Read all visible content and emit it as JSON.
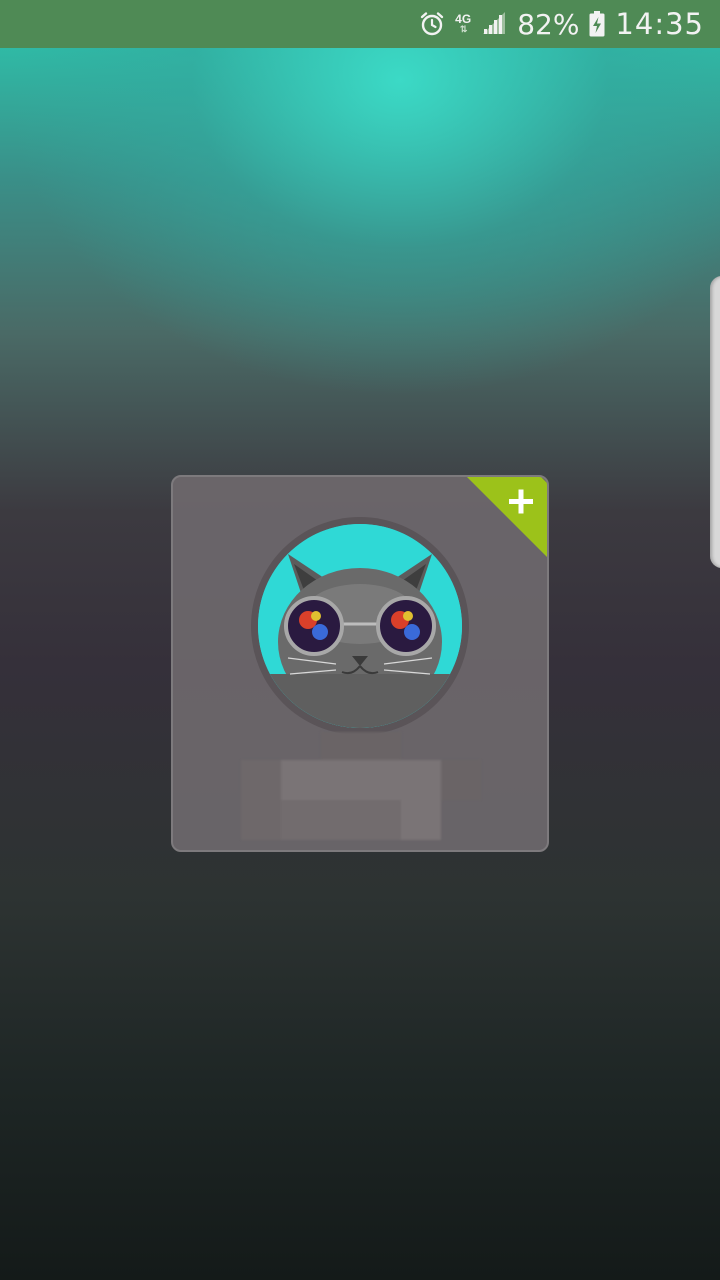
{
  "status_bar": {
    "network_type": "4G",
    "battery_percent": "82%",
    "time": "14:35",
    "icons": [
      "alarm-icon",
      "network-4g-icon",
      "signal-icon",
      "battery-charging-icon"
    ],
    "background_color": "#4f8a55"
  },
  "contact_card": {
    "avatar_description_icon": "cat-with-sunglasses-avatar",
    "add_badge_icon": "plus-icon",
    "add_badge_color": "#9cc21a",
    "name": ""
  },
  "edge_panel": {
    "handle_icon": "edge-panel-handle"
  }
}
